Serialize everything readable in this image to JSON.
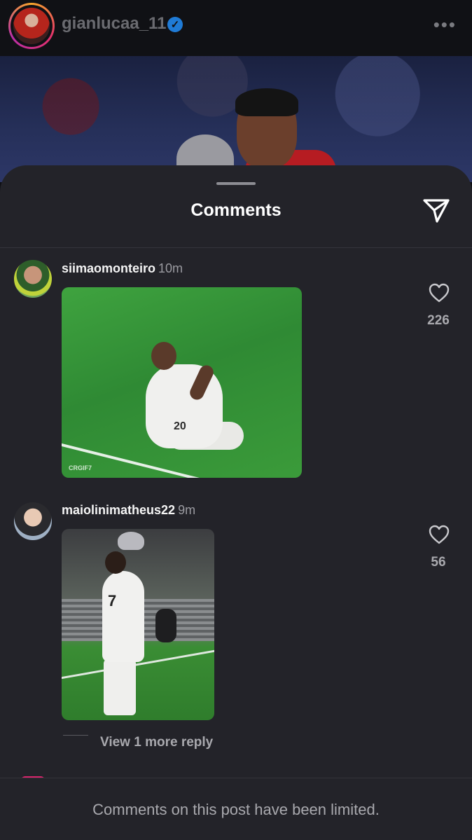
{
  "post": {
    "username": "gianlucaa_11",
    "verified_icon": "verified-badge-icon",
    "more_icon": "more-options-icon",
    "more_label": "•••"
  },
  "sheet": {
    "title": "Comments",
    "share_icon": "send-icon"
  },
  "comments": [
    {
      "username": "siimaomonteiro",
      "time": "10m",
      "likes": "226",
      "gif_watermark": "CRGIF7",
      "gif_jersey_number": "20"
    },
    {
      "username": "maiolinimatheus22",
      "time": "9m",
      "likes": "56",
      "gif_jersey_number": "7",
      "view_replies": "View 1 more reply"
    }
  ],
  "footer": {
    "text": "Comments on this post have been limited."
  },
  "colors": {
    "sheet_bg": "#232329",
    "accent_verified": "#1f7bd6",
    "muted_text": "#a9a9ae"
  }
}
